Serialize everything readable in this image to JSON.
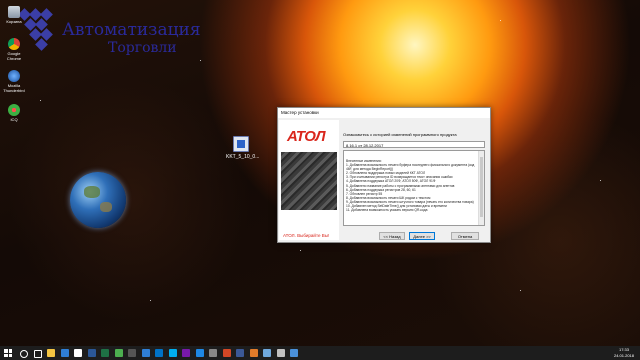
{
  "desktop": {
    "logo": {
      "line1": "Автоматизация",
      "line2": "Торговли"
    },
    "icons": [
      {
        "label": "Корзина",
        "name": "recycle-bin-icon"
      },
      {
        "label": "Google Chrome",
        "name": "chrome-icon"
      },
      {
        "label": "Mozilla Thunderbird",
        "name": "thunderbird-icon"
      },
      {
        "label": "ICQ",
        "name": "icq-icon"
      }
    ],
    "file_icon": {
      "label": "KKT_5_10_0...",
      "name": "installer-file-icon"
    }
  },
  "dialog": {
    "title": "Мастер установки",
    "brand": "АТОЛ",
    "slogan": "АТОЛ. Выбирайте Вы!",
    "caption": "Ознакомьтесь с историей изменений программного продукта",
    "version_line": "8.16.1 от 28.12.2017",
    "changelog": [
      "Внесенные изменения:",
      "1. Добавлена возможность печати буфера последнего фискального документа (код 46F, для метода BeginReport())",
      "2. Обновлена поддержка новых моделей ККТ АТОЛ",
      "3. При считывании регистра ID возвращается текст описания ошибки",
      "4. Добавлена поддержка АТОЛ 20Ф, АТОЛ 50Ф, АТОЛ 91Ф",
      "5. Добавлено название работы с программными агентами для агентов",
      "6. Добавлена поддержка регистров 28, 60, 61",
      "7. Обновлен регистр 55",
      "8. Добавлена возможность печати ШК рядом с текстом",
      "9. Добавлена возможность печати штучного товара (печать его количества товара)",
      "10. Добавлен метод SetDateTime() для установки даты и времени",
      "11. Добавлена возможность указать версию QR-кода"
    ],
    "buttons": {
      "back": "<< Назад",
      "next": "Далее >>",
      "cancel": "Отмена"
    }
  },
  "taskbar": {
    "time": "17:33",
    "date": "24.01.2018",
    "apps": [
      {
        "name": "search-icon",
        "color": "#ffffff"
      },
      {
        "name": "task-view-icon",
        "color": "#ffffff"
      },
      {
        "name": "file-explorer-icon",
        "color": "#f4c542"
      },
      {
        "name": "edge-icon",
        "color": "#2f7fd6"
      },
      {
        "name": "store-icon",
        "color": "#ffffff"
      },
      {
        "name": "word-icon",
        "color": "#2b5797"
      },
      {
        "name": "excel-icon",
        "color": "#1e7145"
      },
      {
        "name": "chrome-icon",
        "color": "#4caf50"
      },
      {
        "name": "app-icon",
        "color": "#555555"
      },
      {
        "name": "media-icon",
        "color": "#2f7fd6"
      },
      {
        "name": "outlook-icon",
        "color": "#0072c6"
      },
      {
        "name": "skype-icon",
        "color": "#00aff0"
      },
      {
        "name": "onenote-icon",
        "color": "#7719aa"
      },
      {
        "name": "app2-icon",
        "color": "#1e88e5"
      },
      {
        "name": "calculator-icon",
        "color": "#888888"
      },
      {
        "name": "powerpoint-icon",
        "color": "#d24726"
      },
      {
        "name": "video-icon",
        "color": "#3b5998"
      },
      {
        "name": "installer-icon",
        "color": "#e07b2a"
      },
      {
        "name": "notepad-icon",
        "color": "#6fa8dc"
      },
      {
        "name": "app3-icon",
        "color": "#c0c0c0"
      },
      {
        "name": "app4-icon",
        "color": "#4a90d9"
      }
    ]
  }
}
